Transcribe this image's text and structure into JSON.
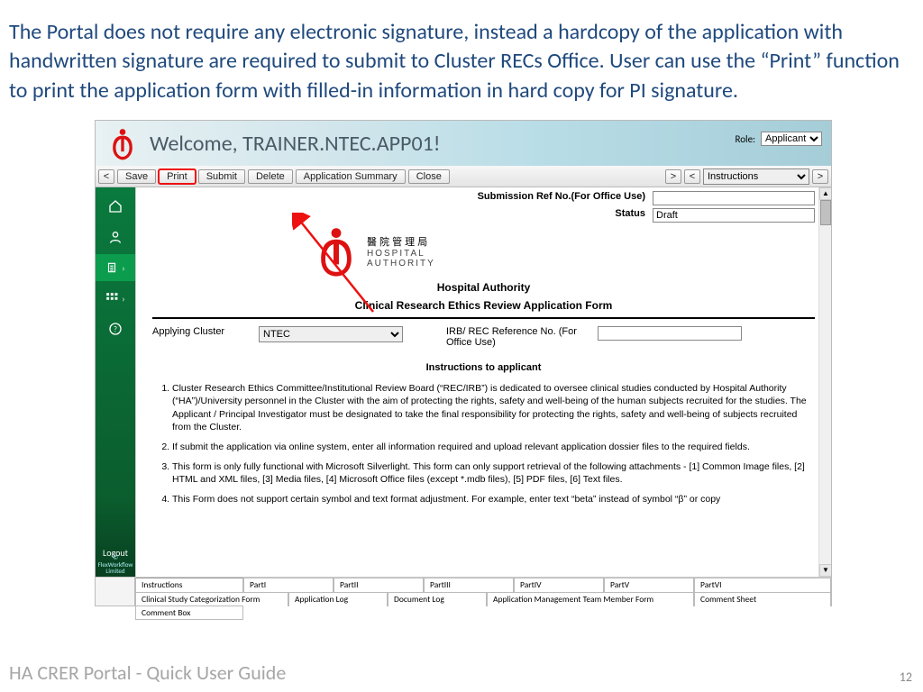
{
  "intro": "The Portal does not require any electronic signature, instead a hardcopy of the application with handwritten signature are required to submit to Cluster RECs Office. User can use the “Print” function to print the application form with filled-in information in hard copy for PI signature.",
  "banner": {
    "welcome": "Welcome, TRAINER.NTEC.APP01!",
    "role_label": "Role:",
    "role_value": "Applicant"
  },
  "toolbar": {
    "nav_prev": "<",
    "save": "Save",
    "print": "Print",
    "submit": "Submit",
    "delete": "Delete",
    "app_summary": "Application Summary",
    "close": "Close",
    "nav_next": ">",
    "nav_prev2": "<",
    "instructions": "Instructions",
    "nav_next2": ">"
  },
  "sidebar": {
    "logout": "Logout",
    "copyright": "© FlexWorkflow Limited"
  },
  "form": {
    "sub_ref_label": "Submission Ref No.(For Office Use)",
    "sub_ref_value": "",
    "status_label": "Status",
    "status_value": "Draft",
    "org_cn": "醫 院 管 理 局",
    "org_en1": "HOSPITAL",
    "org_en2": "AUTHORITY",
    "hospital_title": "Hospital Authority",
    "form_title": "Clinical Research Ethics Review Application Form",
    "cluster_label": "Applying Cluster",
    "cluster_value": "NTEC",
    "irb_label": "IRB/ REC Reference No. (For Office Use)",
    "irb_value": "",
    "instructions_header": "Instructions to applicant",
    "instructions": [
      "Cluster Research Ethics Committee/Institutional Review Board (“REC/IRB”) is dedicated to oversee clinical studies conducted by Hospital Authority (“HA”)/University personnel in the Cluster with the aim of protecting the rights, safety and well-being of the human subjects recruited for the studies. The Applicant / Principal Investigator must be designated to take the final responsibility for protecting the rights, safety and well-being of subjects recruited from the Cluster.",
      "If submit the application via online system, enter all information required and upload relevant application dossier files to the required fields.",
      "This form is only fully functional with Microsoft Silverlight. This form can only support retrieval of the following attachments - [1] Common Image files, [2] HTML and XML files, [3] Media files, [4] Microsoft Office files (except *.mdb files), [5] PDF files, [6] Text files.",
      "This Form does not support certain symbol and text format adjustment. For example, enter text “beta” instead of symbol “β” or copy"
    ]
  },
  "tabs": {
    "row1": [
      "Instructions",
      "PartI",
      "PartII",
      "PartIII",
      "PartIV",
      "PartV",
      "PartVI"
    ],
    "row2": [
      "Clinical Study Categorization Form",
      "Application Log",
      "Document Log",
      "Application Management Team Member Form",
      "Comment Sheet"
    ],
    "row3": [
      "Comment Box"
    ]
  },
  "footer": {
    "title": "HA CRER Portal - Quick User Guide",
    "page": "12"
  }
}
